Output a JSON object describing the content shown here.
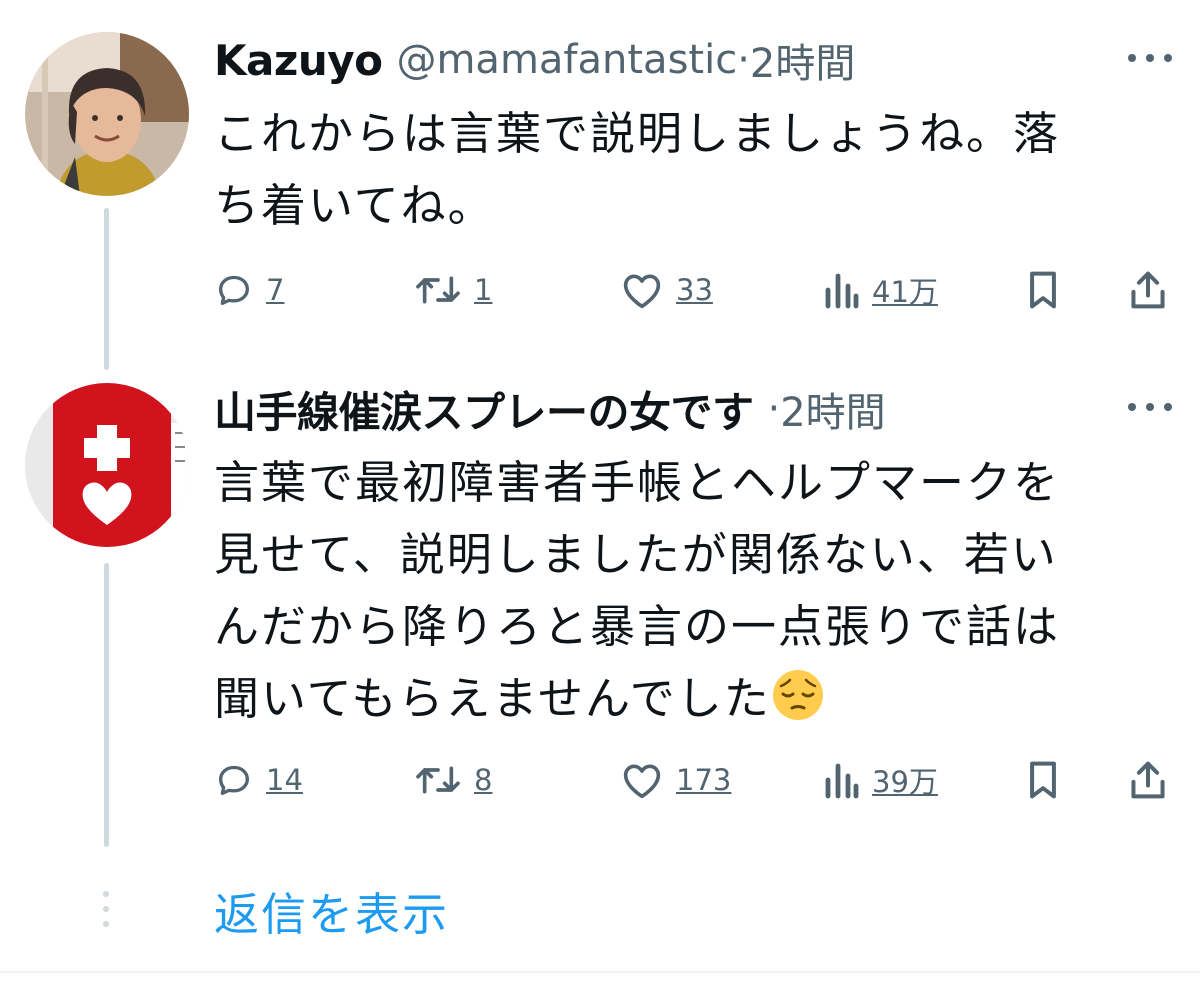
{
  "tweets": [
    {
      "name": "Kazuyo",
      "handle": "@mamafantastic",
      "separator": "·",
      "time": "2時間",
      "text": "これからは言葉で説明しましょうね。落\nち着いてね。",
      "replies": "7",
      "retweets": "1",
      "likes": "33",
      "views": "41万",
      "icons": [
        "reply-icon",
        "retweet-icon",
        "like-icon",
        "views-icon",
        "bookmark-icon",
        "share-icon"
      ]
    },
    {
      "name": "山手線催涙スプレーの女です",
      "separator": "·",
      "time": "2時間",
      "text": "言葉で最初障害者手帳とヘルプマークを\n見せて、説明しましたが関係ない、若い\nんだから降りろと暴言の一点張りで話は\n聞いてもらえませんでした",
      "emoji": "pensive-face",
      "replies": "14",
      "retweets": "8",
      "likes": "173",
      "views": "39万",
      "icons": [
        "reply-icon",
        "retweet-icon",
        "like-icon",
        "views-icon",
        "bookmark-icon",
        "share-icon"
      ]
    }
  ],
  "show_replies": "返信を表示",
  "colors": {
    "text": "#0f1419",
    "secondary": "#536471",
    "link": "#1d9bf0",
    "thread_line": "#cfd9de",
    "help_mark_red": "#d0131d"
  }
}
